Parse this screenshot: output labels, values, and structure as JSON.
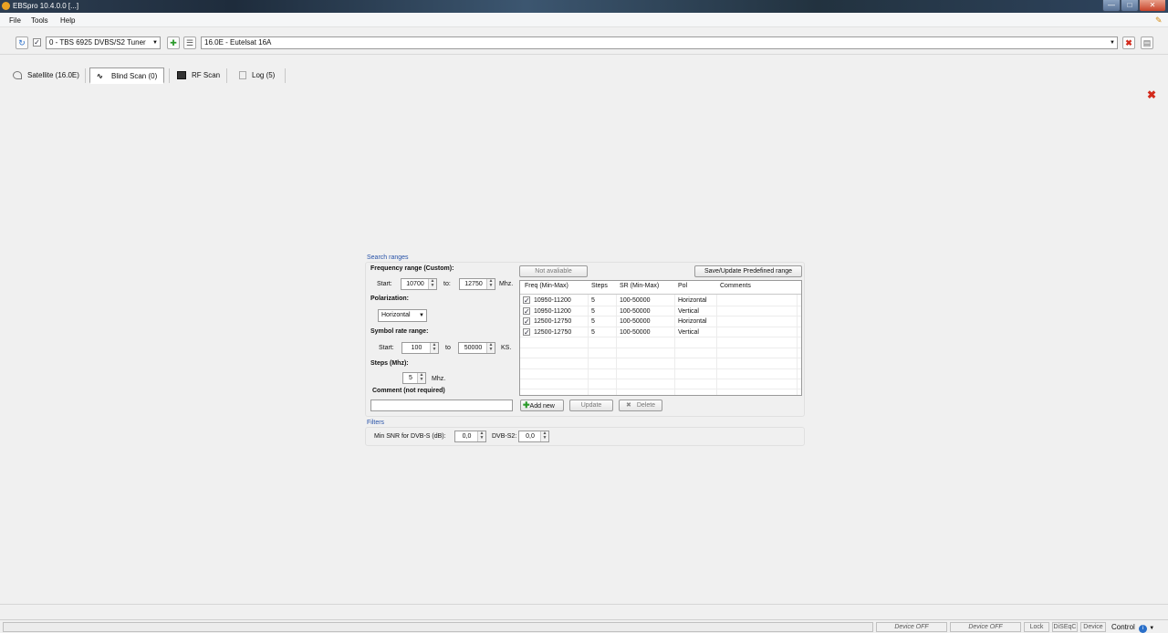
{
  "window": {
    "title": "EBSpro 10.4.0.0 [...]",
    "controls": {
      "minimize": "—",
      "maximize": "□",
      "close": "✕"
    }
  },
  "menu": [
    "File",
    "Tools",
    "Help"
  ],
  "toolbar": {
    "tuner_checked": "✓",
    "tuner": "0 - TBS 6925 DVBS/S2 Tuner",
    "satellite": "16.0E - Eutelsat 16A"
  },
  "tabs": [
    {
      "label": "Satellite (16.0E)"
    },
    {
      "label": "Blind Scan (0)",
      "active": true
    },
    {
      "label": "RF Scan"
    },
    {
      "label": "Log (5)"
    }
  ],
  "search": {
    "section_title": "Search ranges",
    "freq_label": "Frequency range (Custom):",
    "start_label": "Start:",
    "start_value": "10700",
    "to_label": "to:",
    "to_value": "12750",
    "freq_unit": "Mhz.",
    "polarization_label": "Polarization:",
    "polarization_value": "Horizontal",
    "sr_label": "Symbol rate range:",
    "sr_start_label": "Start:",
    "sr_start_value": "100",
    "sr_to_label": "to",
    "sr_to_value": "50000",
    "sr_unit": "KS.",
    "steps_label": "Steps (Mhz):",
    "steps_value": "5",
    "steps_unit": "Mhz.",
    "comment_label": "Comment (not required)",
    "comment_value": ""
  },
  "predefined": {
    "not_available_label": "Not avaliable",
    "save_update_label": "Save/Update Predefined range",
    "columns": [
      "Freq (Min-Max)",
      "Steps",
      "SR (Min-Max)",
      "Pol",
      "Comments"
    ],
    "rows": [
      {
        "checked": "✓",
        "freq": "10950-11200",
        "steps": "5",
        "sr": "100-50000",
        "pol": "Horizontal",
        "comments": ""
      },
      {
        "checked": "✓",
        "freq": "10950-11200",
        "steps": "5",
        "sr": "100-50000",
        "pol": "Vertical",
        "comments": ""
      },
      {
        "checked": "✓",
        "freq": "12500-12750",
        "steps": "5",
        "sr": "100-50000",
        "pol": "Horizontal",
        "comments": ""
      },
      {
        "checked": "✓",
        "freq": "12500-12750",
        "steps": "5",
        "sr": "100-50000",
        "pol": "Vertical",
        "comments": ""
      }
    ],
    "add_new_label": "Add new",
    "update_label": "Update",
    "delete_label": "Delete"
  },
  "filters": {
    "section_title": "Filters",
    "snr_label": "Min SNR for DVB-S (dB):",
    "snr_value": "0,0",
    "dvbs2_label": "DVB-S2:",
    "dvbs2_value": "0,0"
  },
  "statusbar": {
    "device1": "Device OFF",
    "device2": "Device OFF",
    "lock": "Lock",
    "diseqc": "DiSEqC",
    "device": "Device",
    "control": "Control"
  },
  "colors": {
    "accent": "#2752a8",
    "danger": "#d32a1c",
    "add": "#2a9a2a"
  }
}
